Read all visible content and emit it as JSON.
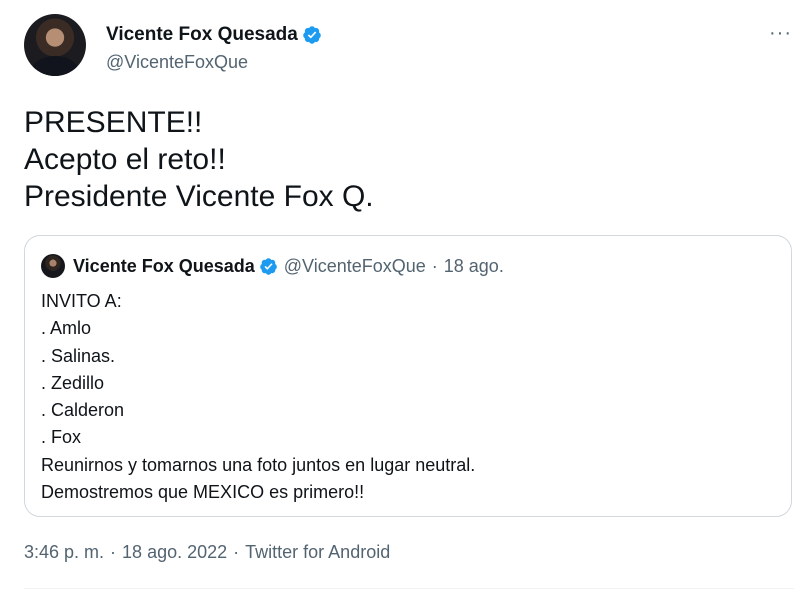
{
  "author": {
    "display_name": "Vicente Fox Quesada",
    "handle": "@VicenteFoxQue"
  },
  "tweet": {
    "lines": [
      "PRESENTE!!",
      "Acepto el reto!!",
      "Presidente Vicente Fox Q."
    ]
  },
  "quoted": {
    "display_name": "Vicente Fox Quesada",
    "handle": "@VicenteFoxQue",
    "separator": "·",
    "date": "18 ago.",
    "lines": [
      "INVITO A:",
      ". Amlo",
      ". Salinas.",
      ". Zedillo",
      ". Calderon",
      ". Fox",
      "Reunirnos y tomarnos una foto juntos en lugar neutral.",
      "Demostremos que MEXICO es primero!!"
    ]
  },
  "meta": {
    "time": "3:46 p. m.",
    "separator": "·",
    "date": "18 ago. 2022",
    "source": "Twitter for Android"
  },
  "more_label": "···",
  "colors": {
    "text": "#0f1419",
    "secondary": "#536471",
    "verified": "#1d9bf0",
    "border": "#cfd9de"
  },
  "icons": {
    "verified": "verified-badge-icon",
    "more": "more-options-icon"
  }
}
